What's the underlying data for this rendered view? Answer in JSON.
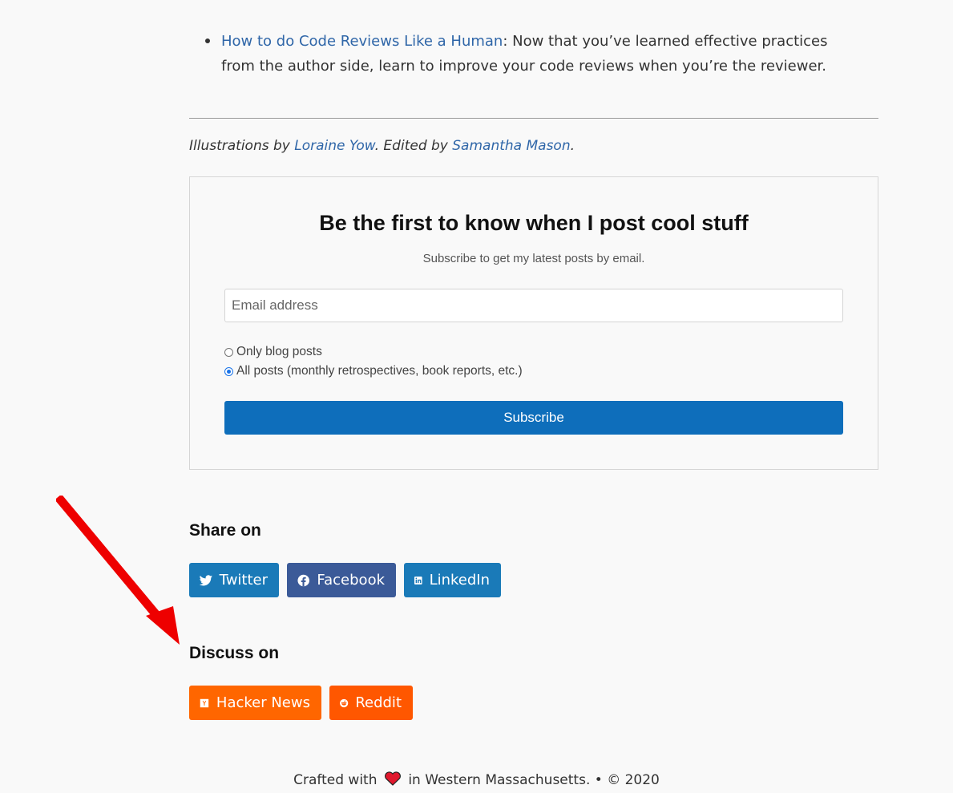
{
  "related": {
    "items": [
      {
        "link_text": "How to do Code Reviews Like a Human",
        "text": ": Now that you’ve learned effective practices from the author side, learn to improve your code reviews when you’re the reviewer."
      }
    ]
  },
  "credits": {
    "prefix": "Illustrations by ",
    "illustrator": "Loraine Yow",
    "middle": ". Edited by ",
    "editor": "Samantha Mason",
    "suffix": "."
  },
  "subscribe": {
    "title": "Be the first to know when I post cool stuff",
    "subtitle": "Subscribe to get my latest posts by email.",
    "email_placeholder": "Email address",
    "options": [
      {
        "label": "Only blog posts",
        "checked": false
      },
      {
        "label": "All posts (monthly retrospectives, book reports, etc.)",
        "checked": true
      }
    ],
    "button_label": "Subscribe"
  },
  "share": {
    "heading": "Share on",
    "buttons": [
      {
        "label": "Twitter",
        "icon": "twitter-icon",
        "color": "#1a7ab8"
      },
      {
        "label": "Facebook",
        "icon": "facebook-icon",
        "color": "#3b5a98"
      },
      {
        "label": "LinkedIn",
        "icon": "linkedin-icon",
        "color": "#1a7ab8"
      }
    ]
  },
  "discuss": {
    "heading": "Discuss on",
    "buttons": [
      {
        "label": "Hacker News",
        "icon": "hacker-news-icon",
        "color": "#ff6600"
      },
      {
        "label": "Reddit",
        "icon": "reddit-icon",
        "color": "#ff5700"
      }
    ]
  },
  "footer": {
    "prefix": "Crafted with",
    "suffix": "in Western Massachusetts. • © 2020"
  },
  "colors": {
    "link": "#2f66a8",
    "subscribe_button": "#0e6ebb",
    "annotation_arrow": "#ee0000"
  }
}
